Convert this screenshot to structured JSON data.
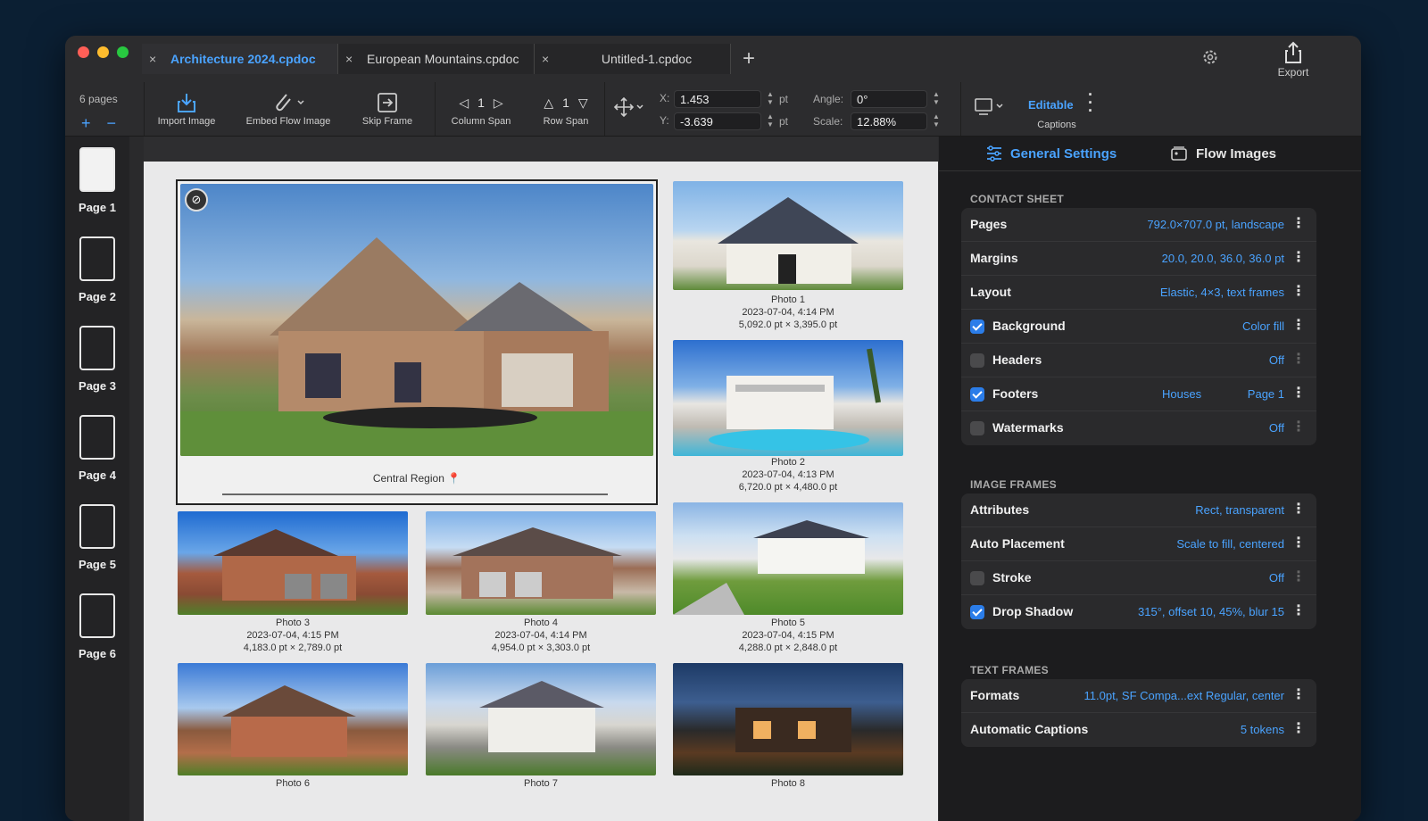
{
  "window": {
    "tabs": [
      {
        "label": "Architecture 2024.cpdoc",
        "active": true
      },
      {
        "label": "European Mountains.cpdoc",
        "active": false
      },
      {
        "label": "Untitled-1.cpdoc",
        "active": false
      }
    ],
    "new_tab_glyph": "+",
    "export_label": "Export",
    "close_glyph": "×"
  },
  "toolbar": {
    "page_count": "6 pages",
    "add_glyph": "+",
    "remove_glyph": "−",
    "import_image": "Import Image",
    "embed_flow_image": "Embed Flow Image",
    "skip_frame": "Skip Frame",
    "column_span": "Column Span",
    "column_span_value": "1",
    "row_span": "Row Span",
    "row_span_value": "1",
    "x_label": "X:",
    "x_value": "1.453",
    "y_label": "Y:",
    "y_value": "-3.639",
    "unit": "pt",
    "angle_label": "Angle:",
    "angle_value": "0°",
    "scale_label": "Scale:",
    "scale_value": "12.88%",
    "captions_mode": "Editable",
    "captions_label": "Captions"
  },
  "pages": [
    "Page 1",
    "Page 2",
    "Page 3",
    "Page 4",
    "Page 5",
    "Page 6"
  ],
  "canvas": {
    "central_caption": "Central Region",
    "photos": [
      {
        "name": "Photo 1",
        "date": "2023-07-04, 4:14 PM",
        "size": "5,092.0 pt × 3,395.0 pt"
      },
      {
        "name": "Photo 2",
        "date": "2023-07-04, 4:13 PM",
        "size": "6,720.0 pt × 4,480.0 pt"
      },
      {
        "name": "Photo 3",
        "date": "2023-07-04, 4:15 PM",
        "size": "4,183.0 pt × 2,789.0 pt"
      },
      {
        "name": "Photo 4",
        "date": "2023-07-04, 4:14 PM",
        "size": "4,954.0 pt × 3,303.0 pt"
      },
      {
        "name": "Photo 5",
        "date": "2023-07-04, 4:15 PM",
        "size": "4,288.0 pt × 2,848.0 pt"
      },
      {
        "name": "Photo 6"
      },
      {
        "name": "Photo 7"
      },
      {
        "name": "Photo 8"
      }
    ]
  },
  "panel": {
    "tab_general": "General Settings",
    "tab_flow": "Flow Images",
    "contact_sheet": {
      "heading": "CONTACT SHEET",
      "pages": {
        "label": "Pages",
        "value": "792.0×707.0 pt, landscape"
      },
      "margins": {
        "label": "Margins",
        "value": "20.0, 20.0, 36.0, 36.0 pt"
      },
      "layout": {
        "label": "Layout",
        "value": "Elastic, 4×3, text frames"
      },
      "background": {
        "label": "Background",
        "value": "Color fill",
        "checked": true
      },
      "headers": {
        "label": "Headers",
        "value": "Off",
        "checked": false
      },
      "footers": {
        "label": "Footers",
        "value": "Houses",
        "value2": "Page 1",
        "checked": true
      },
      "watermarks": {
        "label": "Watermarks",
        "value": "Off",
        "checked": false
      }
    },
    "image_frames": {
      "heading": "IMAGE FRAMES",
      "attributes": {
        "label": "Attributes",
        "value": "Rect, transparent"
      },
      "auto_placement": {
        "label": "Auto Placement",
        "value": "Scale to fill, centered"
      },
      "stroke": {
        "label": "Stroke",
        "value": "Off",
        "checked": false
      },
      "drop_shadow": {
        "label": "Drop Shadow",
        "value": "315°, offset 10, 45%, blur 15",
        "checked": true
      }
    },
    "text_frames": {
      "heading": "TEXT FRAMES",
      "formats": {
        "label": "Formats",
        "value": "11.0pt, SF Compa...ext Regular, center"
      },
      "automatic_captions": {
        "label": "Automatic Captions",
        "value": "5 tokens"
      }
    }
  },
  "colors": {
    "accent": "#4aa3ff",
    "checkbox": "#2b7de9",
    "background": "#0b1f33"
  }
}
